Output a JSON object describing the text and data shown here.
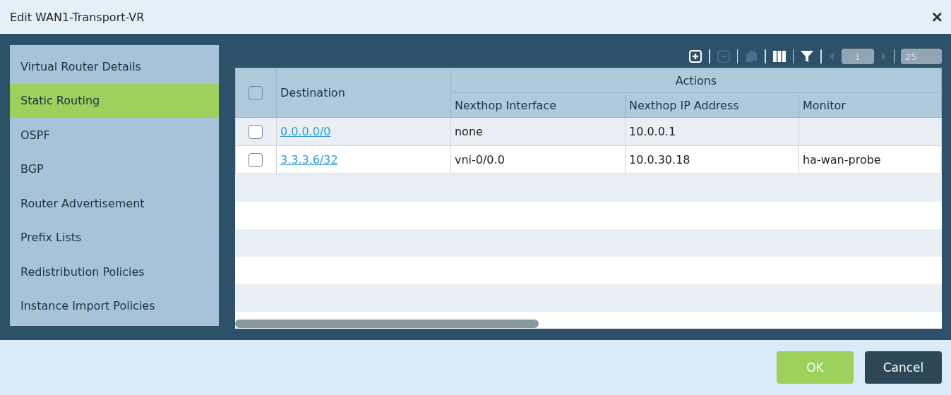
{
  "window": {
    "title": "Edit WAN1-Transport-VR",
    "close": "×"
  },
  "sidebar": {
    "items": [
      {
        "label": "Virtual Router Details",
        "selected": false
      },
      {
        "label": "Static Routing",
        "selected": true
      },
      {
        "label": "OSPF",
        "selected": false
      },
      {
        "label": "BGP",
        "selected": false
      },
      {
        "label": "Router Advertisement",
        "selected": false
      },
      {
        "label": "Prefix Lists",
        "selected": false
      },
      {
        "label": "Redistribution Policies",
        "selected": false
      },
      {
        "label": "Instance Import Policies",
        "selected": false
      }
    ]
  },
  "toolbar": {
    "tools": [
      {
        "kind": "add",
        "disabled": false
      },
      {
        "kind": "remove",
        "disabled": true
      },
      {
        "kind": "clone",
        "disabled": true
      },
      {
        "kind": "columns",
        "disabled": false
      },
      {
        "kind": "filter",
        "disabled": false
      }
    ],
    "page": "1",
    "page_size": "25"
  },
  "table": {
    "group_header": "Actions",
    "columns": [
      "Destination",
      "Nexthop Interface",
      "Nexthop IP Address",
      "Monitor"
    ],
    "header_checked": false,
    "rows": [
      {
        "checked": false,
        "destination": "0.0.0.0/0",
        "interface": "none",
        "ip": "10.0.0.1",
        "monitor": ""
      },
      {
        "checked": false,
        "destination": "3.3.3.6/32",
        "interface": "vni-0/0.0",
        "ip": "10.0.30.18",
        "monitor": "ha-wan-probe"
      }
    ]
  },
  "buttons": [
    {
      "kind": "primary",
      "label": "OK"
    },
    {
      "kind": "secondary",
      "label": "Cancel"
    }
  ]
}
